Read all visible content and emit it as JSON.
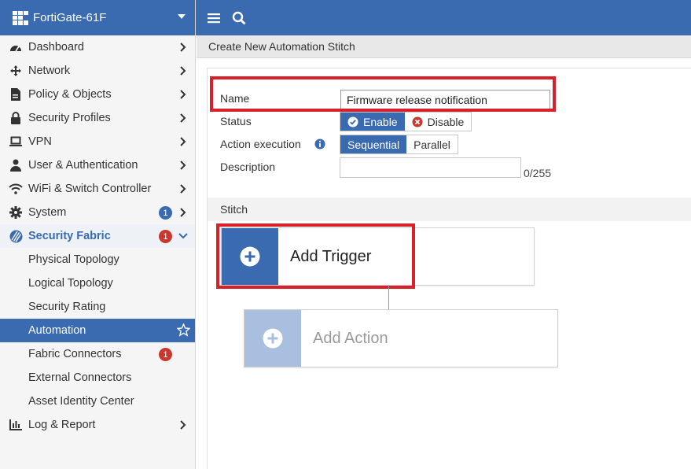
{
  "brand": {
    "title": "FortiGate-61F"
  },
  "topbar": {
    "menu_icon": "hamburger-menu-icon",
    "search_icon": "search-icon"
  },
  "sidebar": {
    "items": [
      {
        "label": "Dashboard",
        "icon": "dashboard-icon"
      },
      {
        "label": "Network",
        "icon": "move-arrows-icon"
      },
      {
        "label": "Policy & Objects",
        "icon": "policy-document-icon"
      },
      {
        "label": "Security Profiles",
        "icon": "lock-icon"
      },
      {
        "label": "VPN",
        "icon": "laptop-icon"
      },
      {
        "label": "User & Authentication",
        "icon": "user-icon"
      },
      {
        "label": "WiFi & Switch Controller",
        "icon": "wifi-icon"
      },
      {
        "label": "System",
        "icon": "gear-icon",
        "badge": "1"
      },
      {
        "label": "Security Fabric",
        "icon": "security-fabric-icon",
        "badge": "1"
      },
      {
        "label": "Log & Report",
        "icon": "bar-chart-icon"
      }
    ],
    "fabric_sub": [
      {
        "label": "Physical Topology"
      },
      {
        "label": "Logical Topology"
      },
      {
        "label": "Security Rating"
      },
      {
        "label": "Automation"
      },
      {
        "label": "Fabric Connectors",
        "badge": "1"
      },
      {
        "label": "External Connectors"
      },
      {
        "label": "Asset Identity Center"
      }
    ]
  },
  "page": {
    "title": "Create New Automation Stitch"
  },
  "form": {
    "name_label": "Name",
    "name_value": "Firmware release notification",
    "status_label": "Status",
    "status_options": [
      "Enable",
      "Disable"
    ],
    "status_selected": "Enable",
    "action_execution_label": "Action execution",
    "execution_options": [
      "Sequential",
      "Parallel"
    ],
    "execution_selected": "Sequential",
    "description_label": "Description",
    "description_value": "",
    "description_counter": "0/255"
  },
  "stitch": {
    "section_label": "Stitch",
    "add_trigger_label": "Add Trigger",
    "add_action_label": "Add Action"
  },
  "colors": {
    "brand": "#3a6ab0",
    "highlight": "#d81f2a",
    "badge_red": "#c8382f"
  }
}
